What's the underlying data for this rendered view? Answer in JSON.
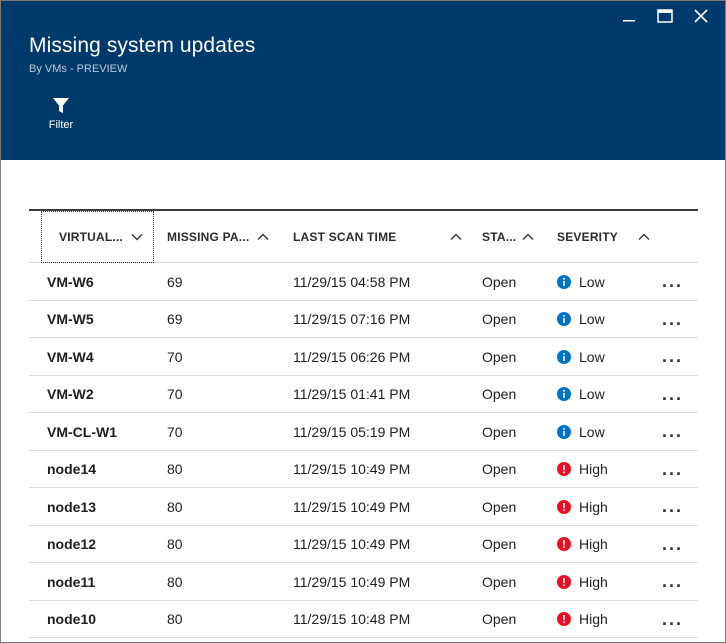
{
  "header": {
    "title": "Missing system updates",
    "subtitle": "By VMs - PREVIEW",
    "filter_label": "Filter"
  },
  "colors": {
    "header_bg": "#003a6b",
    "info_blue": "#0072c6",
    "high_red": "#e81123"
  },
  "table": {
    "columns": [
      {
        "label": "VIRTUAL...",
        "sort": "chevron-down"
      },
      {
        "label": "MISSING PA...",
        "sort": "chevron-up"
      },
      {
        "label": "LAST SCAN TIME",
        "sort": "chevron-up"
      },
      {
        "label": "STA...",
        "sort": "chevron-up"
      },
      {
        "label": "SEVERITY",
        "sort": "chevron-up"
      }
    ],
    "rows": [
      {
        "name": "VM-W6",
        "missing": "69",
        "scan": "11/29/15 04:58 PM",
        "state": "Open",
        "severity": "Low",
        "sev_icon": "info-icon",
        "more": "..."
      },
      {
        "name": "VM-W5",
        "missing": "69",
        "scan": "11/29/15 07:16 PM",
        "state": "Open",
        "severity": "Low",
        "sev_icon": "info-icon",
        "more": "..."
      },
      {
        "name": "VM-W4",
        "missing": "70",
        "scan": "11/29/15 06:26 PM",
        "state": "Open",
        "severity": "Low",
        "sev_icon": "info-icon",
        "more": "..."
      },
      {
        "name": "VM-W2",
        "missing": "70",
        "scan": "11/29/15 01:41 PM",
        "state": "Open",
        "severity": "Low",
        "sev_icon": "info-icon",
        "more": "..."
      },
      {
        "name": "VM-CL-W1",
        "missing": "70",
        "scan": "11/29/15 05:19 PM",
        "state": "Open",
        "severity": "Low",
        "sev_icon": "info-icon",
        "more": "..."
      },
      {
        "name": "node14",
        "missing": "80",
        "scan": "11/29/15 10:49 PM",
        "state": "Open",
        "severity": "High",
        "sev_icon": "alert-icon",
        "more": "..."
      },
      {
        "name": "node13",
        "missing": "80",
        "scan": "11/29/15 10:49 PM",
        "state": "Open",
        "severity": "High",
        "sev_icon": "alert-icon",
        "more": "..."
      },
      {
        "name": "node12",
        "missing": "80",
        "scan": "11/29/15 10:49 PM",
        "state": "Open",
        "severity": "High",
        "sev_icon": "alert-icon",
        "more": "..."
      },
      {
        "name": "node11",
        "missing": "80",
        "scan": "11/29/15 10:49 PM",
        "state": "Open",
        "severity": "High",
        "sev_icon": "alert-icon",
        "more": "..."
      },
      {
        "name": "node10",
        "missing": "80",
        "scan": "11/29/15 10:48 PM",
        "state": "Open",
        "severity": "High",
        "sev_icon": "alert-icon",
        "more": "..."
      }
    ]
  }
}
